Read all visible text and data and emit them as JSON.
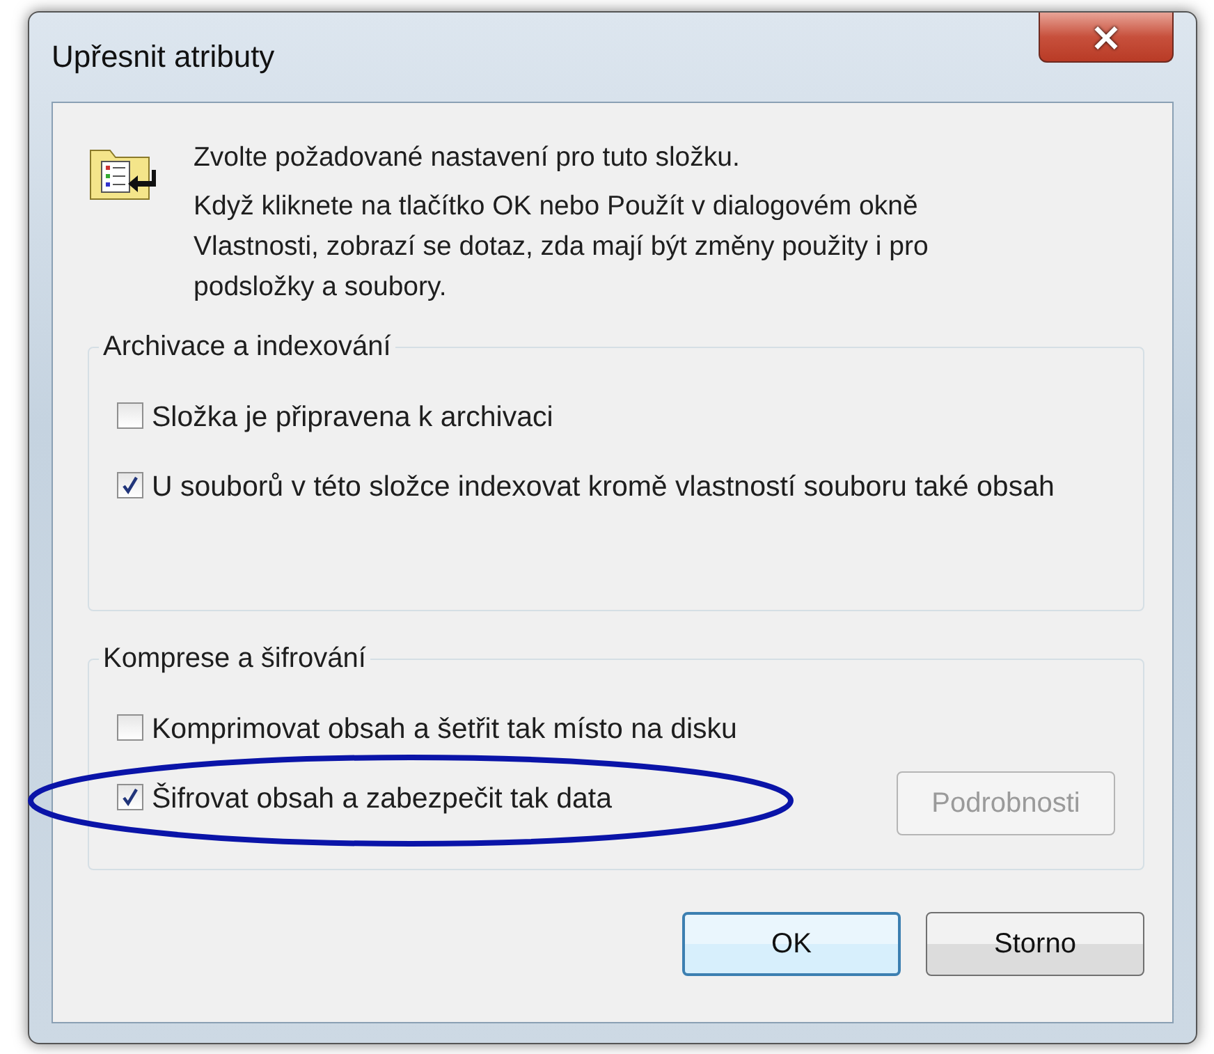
{
  "window": {
    "title": "Upřesnit atributy",
    "close_button": "×"
  },
  "intro": {
    "heading": "Zvolte požadované nastavení pro tuto složku.",
    "text": "Když kliknete na tlačítko OK nebo Použít v dialogovém okně Vlastnosti, zobrazí se dotaz, zda mají být změny použity i pro podsložky a soubory."
  },
  "groups": [
    {
      "title": "Archivace a indexování",
      "options": [
        {
          "label": "Složka je připravena k archivaci",
          "checked": false
        },
        {
          "label": "U souborů v této složce indexovat kromě vlastností souboru také obsah",
          "checked": true
        }
      ]
    },
    {
      "title": "Komprese a šifrování",
      "options": [
        {
          "label": "Komprimovat obsah a šetřit tak místo na disku",
          "checked": false
        },
        {
          "label": "Šifrovat obsah a zabezpečit tak data",
          "checked": true,
          "highlighted": true
        }
      ],
      "button": {
        "label": "Podrobnosti",
        "disabled": true
      }
    }
  ],
  "buttons": [
    {
      "label": "OK",
      "default": true
    },
    {
      "label": "Storno",
      "default": false
    }
  ]
}
